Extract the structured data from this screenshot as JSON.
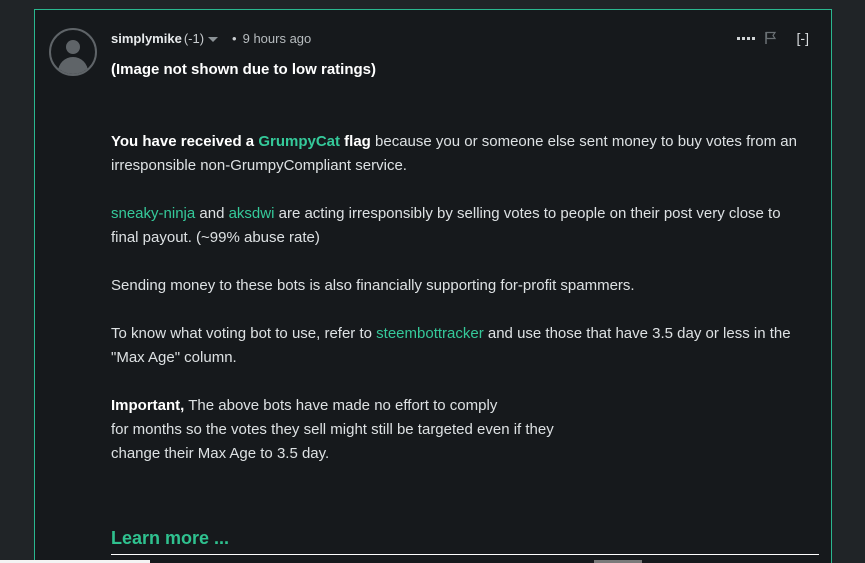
{
  "comment": {
    "author": "simplymike",
    "reputation": "(-1)",
    "dot": "•",
    "time_ago": "9 hours ago",
    "collapse_label": "[-]",
    "image_hidden_notice": "(Image not shown due to low ratings)",
    "p1_prefix": "You have received a ",
    "p1_link": "GrumpyCat",
    "p1_flag": " flag",
    "p1_rest": " because you or someone else sent money to buy votes from an irresponsible non-GrumpyCompliant service.",
    "p2_link1": "sneaky-ninja",
    "p2_and": " and ",
    "p2_link2": "aksdwi",
    "p2_rest": " are acting irresponsibly by selling votes to people on their post very close to final payout. (~99% abuse rate)",
    "p3": "Sending money to these bots is also financially supporting for-profit spammers.",
    "p4_prefix": "To know what voting bot to use, refer to ",
    "p4_link": "steembottracker",
    "p4_rest": " and use those that have 3.5 day or less in the \"Max Age\" column.",
    "p5_strong": "Important,",
    "p5_line1": " The above bots have made no effort to comply",
    "p5_line2": "for months so the votes they sell might still be targeted even if they",
    "p5_line3": "change their Max Age to 3.5 day.",
    "learn_more": "Learn more ..."
  },
  "icons": {
    "avatar": "user-avatar-icon",
    "more": "more-options-icon",
    "flag": "flag-icon",
    "caret": "chevron-down-icon"
  },
  "colors": {
    "accent": "#35c99a",
    "card_border": "#2ab78f",
    "background": "#16191c"
  }
}
